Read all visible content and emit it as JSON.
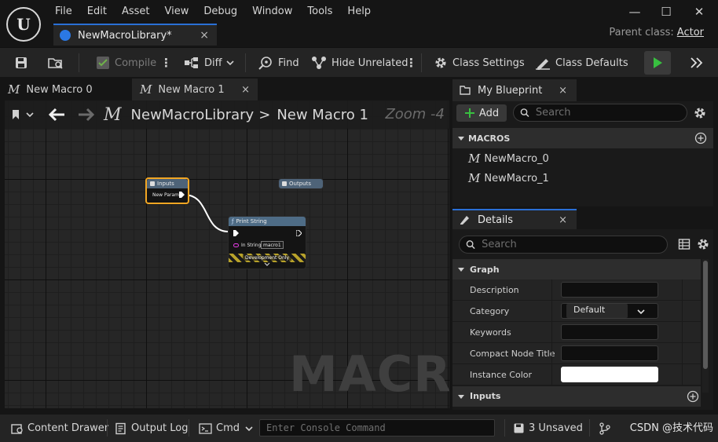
{
  "menu": [
    "File",
    "Edit",
    "Asset",
    "View",
    "Debug",
    "Window",
    "Tools",
    "Help"
  ],
  "asset_tab": {
    "label": "NewMacroLibrary*",
    "close": "×"
  },
  "window": {
    "minimize": "—",
    "maximize": "☐",
    "close": "✕"
  },
  "parent_class": {
    "label": "Parent class:",
    "value": "Actor"
  },
  "toolbar": {
    "compile": "Compile",
    "diff": "Diff",
    "find": "Find",
    "hide_unrelated": "Hide Unrelated",
    "class_settings": "Class Settings",
    "class_defaults": "Class Defaults",
    "more": "⋮"
  },
  "graph_tabs": [
    {
      "label": "New Macro 0",
      "close": ""
    },
    {
      "label": "New Macro 1",
      "close": "×"
    }
  ],
  "breadcrumb": {
    "library": "NewMacroLibrary",
    "separator": ">",
    "macro": "New Macro 1",
    "zoom": "Zoom -4"
  },
  "graph": {
    "watermark": "MACRO",
    "nodes": {
      "inputs": {
        "title": "Inputs",
        "pin": "New Param"
      },
      "outputs": {
        "title": "Outputs"
      },
      "print_string": {
        "title": "Print String",
        "pin_label": "In String",
        "pin_value": "macro1",
        "dev_only": "Development Only"
      }
    }
  },
  "my_blueprint": {
    "tab": "My Blueprint",
    "close": "×",
    "add": "Add",
    "search_placeholder": "Search",
    "section": "MACROS",
    "items": [
      "NewMacro_0",
      "NewMacro_1"
    ]
  },
  "details": {
    "tab": "Details",
    "close": "×",
    "search_placeholder": "Search",
    "section": "Graph",
    "next_section": "Inputs",
    "properties": [
      {
        "label": "Description",
        "value": ""
      },
      {
        "label": "Category",
        "value": "Default"
      },
      {
        "label": "Keywords",
        "value": ""
      },
      {
        "label": "Compact Node Title",
        "value": ""
      },
      {
        "label": "Instance Color",
        "value": ""
      }
    ]
  },
  "status": {
    "content_drawer": "Content Drawer",
    "output_log": "Output Log",
    "cmd": "Cmd",
    "console_placeholder": "Enter Console Command",
    "unsaved": "3 Unsaved",
    "watermark": "CSDN @技术代码"
  },
  "colors": {
    "accent": "#2a6fd6",
    "play_green": "#38c040",
    "node_selected": "#f2a623",
    "exec_wire": "#ffffff",
    "string_pin": "#e83ce8"
  }
}
